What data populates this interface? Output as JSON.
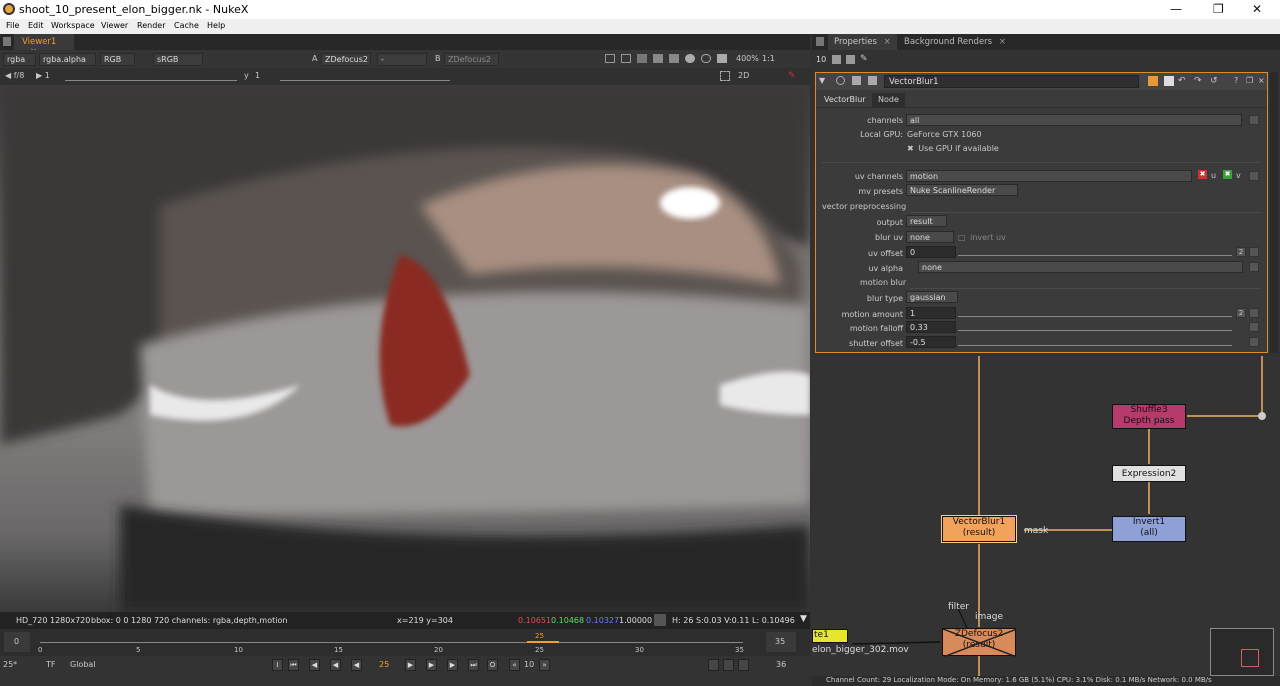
{
  "window": {
    "title": "shoot_10_present_elon_bigger.nk - NukeX"
  },
  "menu": [
    "File",
    "Edit",
    "Workspace",
    "Viewer",
    "Render",
    "Cache",
    "Help"
  ],
  "viewer": {
    "tab_label": "Viewer1",
    "channels": "rgba",
    "alpha": "rgba.alpha",
    "display": "RGB",
    "colorspace": "sRGB",
    "input_a_label": "A",
    "input_a": "ZDefocus2",
    "op": "-",
    "input_b_label": "B",
    "input_b": "ZDefocus2",
    "zoom": "400%",
    "ratio": "1:1",
    "fstop": "f/8",
    "gain": "1",
    "y_label": "y",
    "gamma": "1",
    "mode": "2D",
    "info_format": "HD_720 1280x720",
    "info_bbox": "bbox: 0 0 1280 720 channels: rgba,depth,motion",
    "info_xy": "x=219 y=304",
    "info_r": "0.10651",
    "info_g": "0.10468",
    "info_b": "0.10327",
    "info_a": "1.00000",
    "info_hsv": "H: 26 S:0.03 V:0.11",
    "info_l": "L: 0.10496"
  },
  "timeline": {
    "start": "0",
    "end": "35",
    "ticks": [
      "0",
      "5",
      "10",
      "15",
      "20",
      "25",
      "30",
      "35"
    ],
    "current": "25",
    "marker": "25",
    "fps": "25*",
    "tf": "TF",
    "scope": "Global",
    "step": "10",
    "end_frame": "36"
  },
  "properties": {
    "tab_properties": "Properties",
    "tab_bg_renders": "Background Renders",
    "max_panels": "10",
    "node_name": "VectorBlur1",
    "subtab_1": "VectorBlur",
    "subtab_2": "Node",
    "knobs": {
      "channels_label": "channels",
      "channels": "all",
      "gpu_label": "Local GPU:",
      "gpu": "GeForce GTX 1060",
      "use_gpu": "Use GPU if available",
      "uv_label": "uv channels",
      "uv": "motion",
      "uv_u": "u",
      "uv_v": "v",
      "mv_label": "mv presets",
      "mv": "Nuke ScanlineRender",
      "vector_pre": "vector preprocessing",
      "output_label": "output",
      "output": "result",
      "blur_uv_label": "blur uv",
      "blur_uv": "none",
      "invert_uv": "invert uv",
      "uv_offset_label": "uv offset",
      "uv_offset": "0",
      "uv_alpha_label": "uv alpha",
      "uv_alpha": "none",
      "motion_blur": "motion blur",
      "blur_type_label": "blur type",
      "blur_type": "gaussian",
      "motion_amount_label": "motion amount",
      "motion_amount": "1",
      "motion_falloff_label": "motion falloff",
      "motion_falloff": "0.33",
      "shutter_offset_label": "shutter offset",
      "shutter_offset": "-0.5",
      "dims": "2"
    }
  },
  "nodegraph": {
    "shuffle": "Shuffle3",
    "shuffle_sub": "Depth pass",
    "expression": "Expression2",
    "invert": "Invert1",
    "invert_sub": "(all)",
    "vectorblur": "VectorBlur1",
    "vectorblur_sub": "(result)",
    "mask_label": "mask",
    "zdefocus": "ZDefocus2",
    "zdefocus_sub": "(result)",
    "filter_label": "filter",
    "image_label": "image",
    "write_name": "te1",
    "write_file": "elon_bigger_302.mov"
  },
  "status": "Channel Count: 29  Localization Mode: On  Memory: 1.6 GB (5.1%)  CPU: 3.1%  Disk: 0.1 MB/s  Network: 0.0 MB/s",
  "colors": {
    "accent": "#f6a020",
    "panel_border": "#e08a2e",
    "node_shuffle": "#b63a6b",
    "node_vectorblur": "#f2a25b",
    "node_invert": "#8fa0d6",
    "node_zdefocus": "#d98a5a"
  }
}
